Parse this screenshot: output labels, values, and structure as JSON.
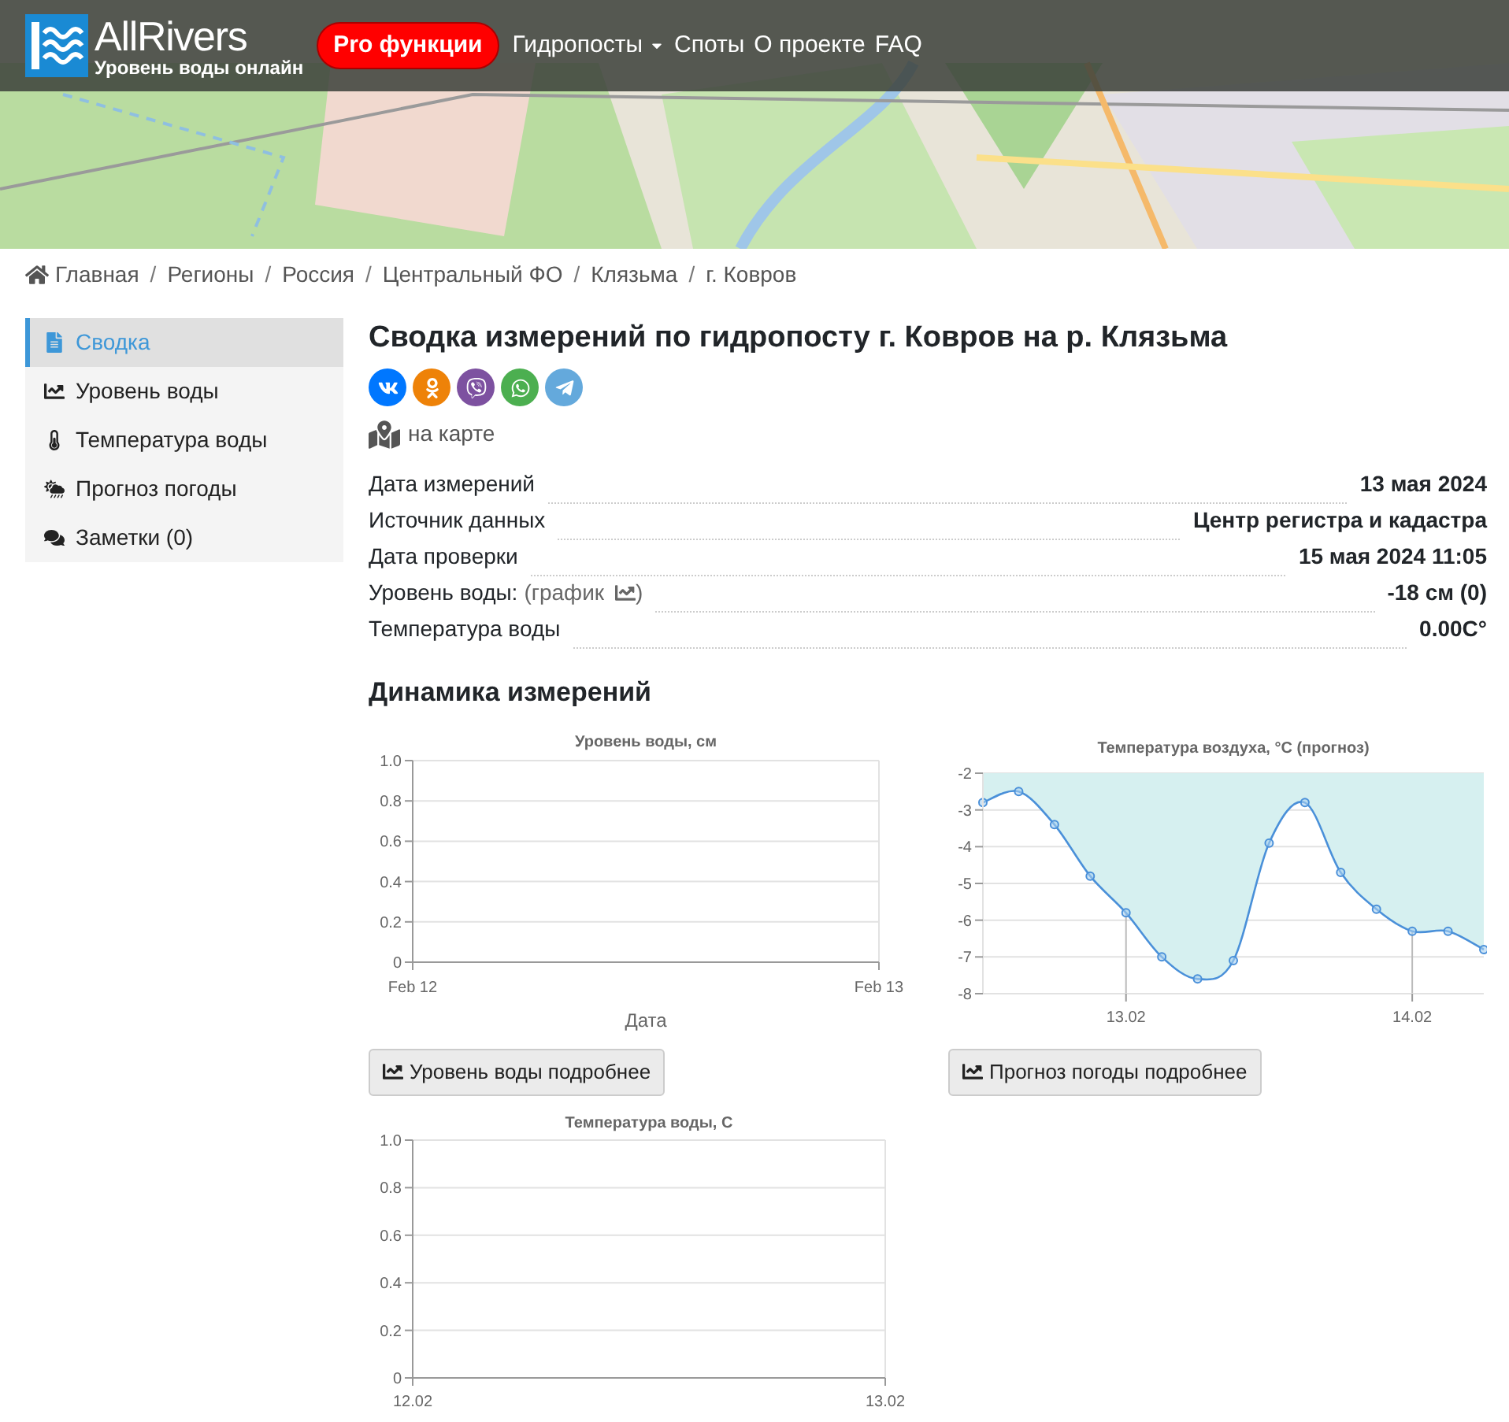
{
  "brand": {
    "name": "AllRivers",
    "tagline": "Уровень воды онлайн"
  },
  "nav": [
    {
      "label": "Pro функции",
      "kind": "pill"
    },
    {
      "label": "Гидропосты",
      "kind": "dropdown"
    },
    {
      "label": "Споты",
      "kind": "link"
    },
    {
      "label": "О проекте",
      "kind": "link"
    },
    {
      "label": "FAQ",
      "kind": "link"
    }
  ],
  "breadcrumb_separator": "/",
  "breadcrumb": [
    "Главная",
    "Регионы",
    "Россия",
    "Центральный ФО",
    "Клязьма",
    "г. Ковров"
  ],
  "sidebar": {
    "items": [
      {
        "label": "Сводка",
        "selected": true
      },
      {
        "label": "Уровень воды",
        "selected": false
      },
      {
        "label": "Температура воды",
        "selected": false
      },
      {
        "label": "Прогноз погоды",
        "selected": false
      },
      {
        "label": "Заметки (0)",
        "selected": false
      }
    ]
  },
  "page_title": "Сводка измерений по гидропосту г. Ковров на р. Клязьма",
  "share": [
    {
      "kind": "vk",
      "color": "#0077ff"
    },
    {
      "kind": "ok",
      "color": "#ee8208"
    },
    {
      "kind": "viber",
      "color": "#7d51a0"
    },
    {
      "kind": "whatsapp",
      "color": "#4caf50"
    },
    {
      "kind": "telegram",
      "color": "#64a9dc"
    }
  ],
  "map_link": "на карте",
  "details": [
    {
      "label": "Дата измерений",
      "value": "13 мая 2024"
    },
    {
      "label": "Источник данных",
      "value": "Центр регистра и кадастра"
    },
    {
      "label": "Дата проверки",
      "value": "15 мая 2024 11:05"
    },
    {
      "label": "Уровень воды:",
      "link": "(график",
      "link_end": ")",
      "value": "-18 см (0)"
    },
    {
      "label": "Температура воды",
      "value": "0.00C°"
    }
  ],
  "dynamics_title": "Динамика измерений",
  "charts": [
    {
      "empty_chart": {
        "title": "Уровень воды, см",
        "x_title": "Дата",
        "x_labels": [
          "Feb 12",
          "Feb 13"
        ],
        "y_labels": [
          "1.0",
          "0.8",
          "0.6",
          "0.4",
          "0.2",
          "0"
        ]
      },
      "button": "Уровень воды подробнее"
    },
    {
      "chart_data": {
        "type": "area",
        "grid": true,
        "title": "Температура воздуха, °C (прогноз)",
        "categories": [
          null,
          null,
          null,
          null,
          "13.02",
          null,
          null,
          null,
          null,
          null,
          null,
          null,
          "14.02",
          null,
          null
        ],
        "ylim": [
          -8,
          -2
        ],
        "yticks": [
          -2,
          -3,
          -4,
          -5,
          -6,
          -7,
          -8
        ],
        "series": [
          {
            "color": "#4a90d9",
            "values": [
              -2.8,
              -2.5,
              -3.4,
              -4.8,
              -5.8,
              -7.0,
              -7.6,
              -7.1,
              -3.9,
              -2.8,
              -4.7,
              -5.7,
              -6.3,
              -6.3,
              -6.8
            ]
          }
        ]
      },
      "button": "Прогноз погоды подробнее"
    },
    {
      "empty_chart": {
        "title": "Температура воды, С",
        "x_labels": [
          "12.02",
          "13.02"
        ],
        "y_labels": [
          "1.0",
          "0.8",
          "0.6",
          "0.4",
          "0.2",
          "0"
        ]
      }
    }
  ]
}
